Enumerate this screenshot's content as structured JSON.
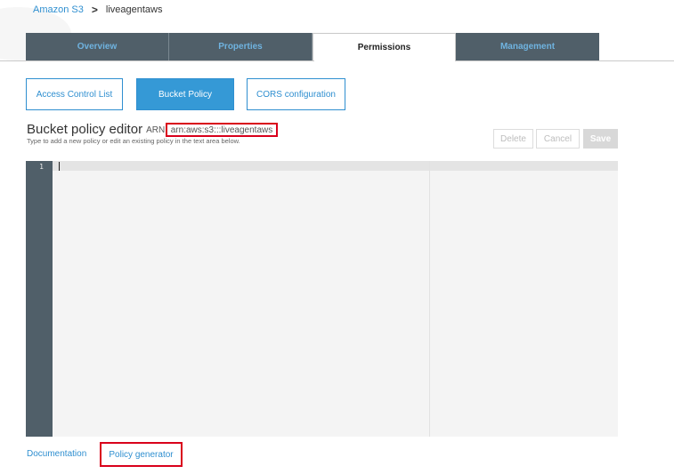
{
  "breadcrumb": {
    "root": "Amazon S3",
    "separator": ">",
    "current": "liveagentaws"
  },
  "tabs": [
    {
      "label": "Overview",
      "active": false
    },
    {
      "label": "Properties",
      "active": false
    },
    {
      "label": "Permissions",
      "active": true
    },
    {
      "label": "Management",
      "active": false
    }
  ],
  "subnav": {
    "acl": "Access Control List",
    "bucket_policy": "Bucket Policy",
    "cors": "CORS configuration"
  },
  "editor": {
    "title": "Bucket policy editor",
    "arn_label": "ARN:",
    "arn_value": "arn:aws:s3:::liveagentaws",
    "hint": "Type to add a new policy or edit an existing policy in the text area below.",
    "line_number": "1"
  },
  "actions": {
    "delete": "Delete",
    "cancel": "Cancel",
    "save": "Save"
  },
  "footer": {
    "documentation": "Documentation",
    "policy_generator": "Policy generator"
  },
  "colors": {
    "accent": "#2f8fd0",
    "tab_dark": "#505f69",
    "highlight_red": "#d9001b"
  }
}
